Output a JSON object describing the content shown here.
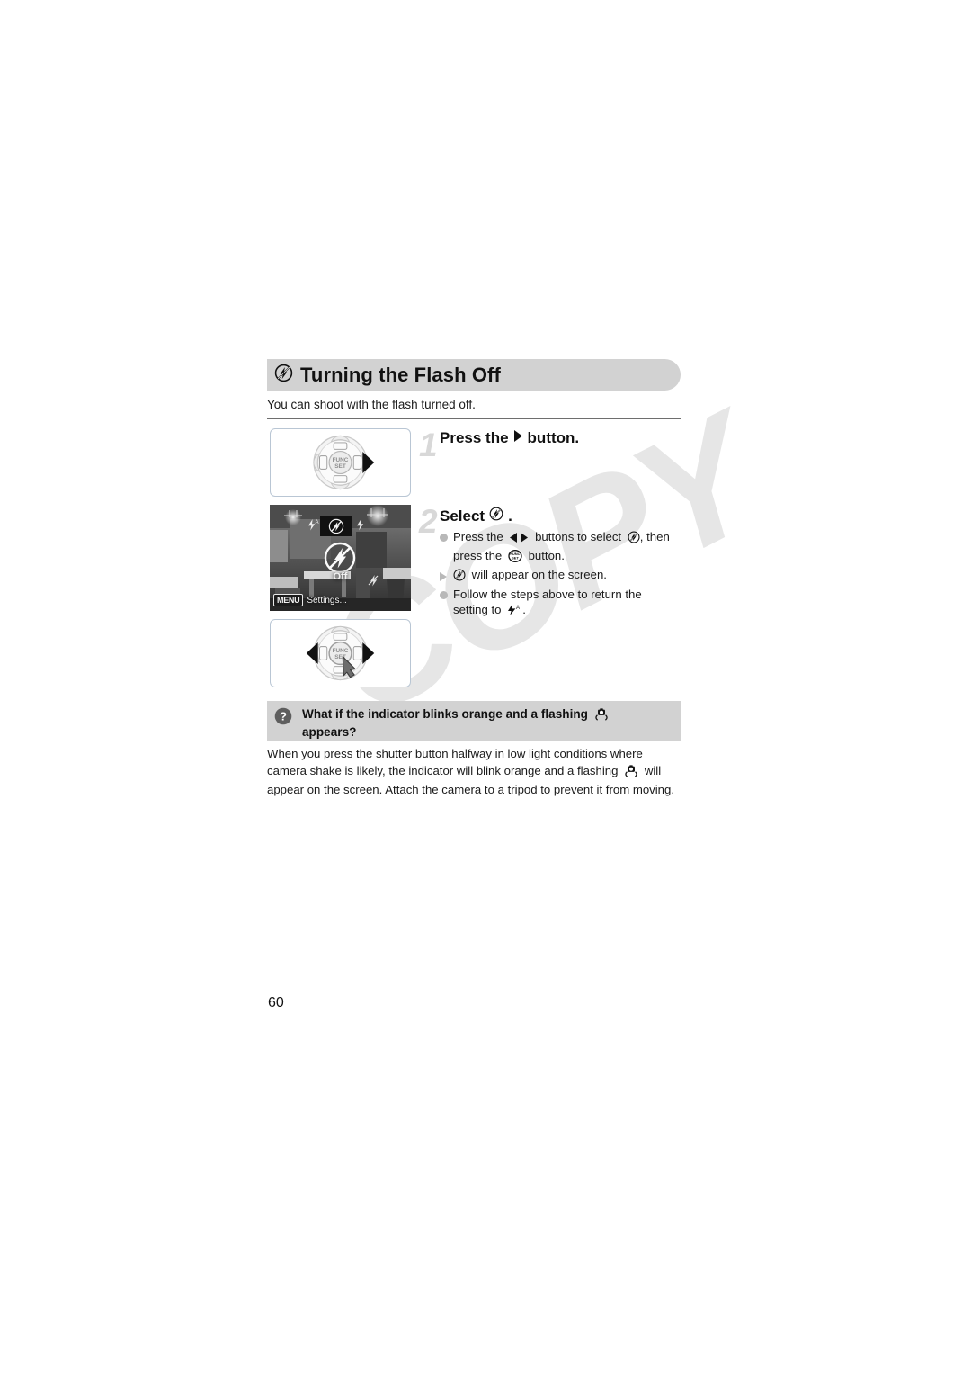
{
  "document": {
    "page_number": "60",
    "watermark": "COPY"
  },
  "section": {
    "icon": "flash-off-icon",
    "title": "Turning the Flash Off",
    "intro": "You can shoot with the flash turned off."
  },
  "steps": [
    {
      "number": "1",
      "heading_before": "Press the",
      "heading_icon": "right-arrow-button-icon",
      "heading_after": "button.",
      "figure": "control-dial-right-button-figure"
    },
    {
      "number": "2",
      "heading_before": "Select",
      "heading_icon": "flash-off-icon",
      "heading_after": ".",
      "figure": "camera-screen-flash-off-figure",
      "bullets": [
        {
          "marker": "dot",
          "line1_a": "Press the",
          "icon1": "left-right-buttons-icon",
          "line1_b": "buttons to select",
          "icon2": "flash-off-icon",
          "line1_c": ", then",
          "line2_a": "press the",
          "icon3": "func-set-button-icon",
          "line2_b": "button."
        },
        {
          "marker": "triangle",
          "icon1": "flash-off-icon",
          "line1_a": "will appear on the screen."
        },
        {
          "marker": "dot",
          "line1_a": "Follow the steps above to return the",
          "line2_a": "setting to",
          "icon1": "flash-auto-icon",
          "line2_b": "."
        }
      ]
    }
  ],
  "camera_screen": {
    "menu_chip": "MENU",
    "menu_label": "Settings...",
    "mode_label": "Off",
    "options": [
      "flash-auto-icon",
      "flash-off-icon",
      "flash-on-icon",
      "flash-slow-sync-icon"
    ]
  },
  "qa": {
    "icon": "question-mark-icon",
    "title_a": "What if the indicator blinks orange and a flashing",
    "title_icon": "camera-shake-icon",
    "title_b": "appears?",
    "body_a": "When you press the shutter button halfway in low light conditions where camera shake is likely, the indicator will blink orange and a flashing",
    "body_icon": "camera-shake-icon",
    "body_b": "will appear on the screen. Attach the camera to a tripod to prevent it from moving."
  },
  "colors": {
    "header_bar": "#d2d2d2",
    "step_number": "#d8d8d8",
    "bullet_marker": "#b8b8b8",
    "rule": "#6e6e6e",
    "watermark": "#e6e6e6"
  }
}
